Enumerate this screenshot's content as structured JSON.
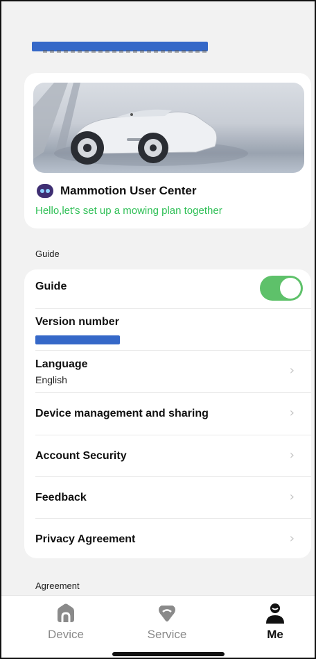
{
  "user_card": {
    "title": "Mammotion User Center",
    "subtitle": "Hello,let's set up a mowing plan together"
  },
  "sections": {
    "guide_label": "Guide",
    "agreement_label": "Agreement"
  },
  "settings": {
    "guide": {
      "label": "Guide",
      "toggle_on": true
    },
    "version": {
      "label": "Version number"
    },
    "language": {
      "label": "Language",
      "value": "English"
    },
    "device_management": {
      "label": "Device management and sharing"
    },
    "account_security": {
      "label": "Account Security"
    },
    "feedback": {
      "label": "Feedback"
    },
    "privacy": {
      "label": "Privacy Agreement"
    }
  },
  "tabs": [
    {
      "label": "Device",
      "icon": "home-icon",
      "active": false
    },
    {
      "label": "Service",
      "icon": "service-icon",
      "active": false
    },
    {
      "label": "Me",
      "icon": "person-icon",
      "active": true
    }
  ],
  "colors": {
    "accent_green": "#2ebf55",
    "toggle_green": "#5ec16a",
    "redaction_blue": "#3568c8"
  }
}
